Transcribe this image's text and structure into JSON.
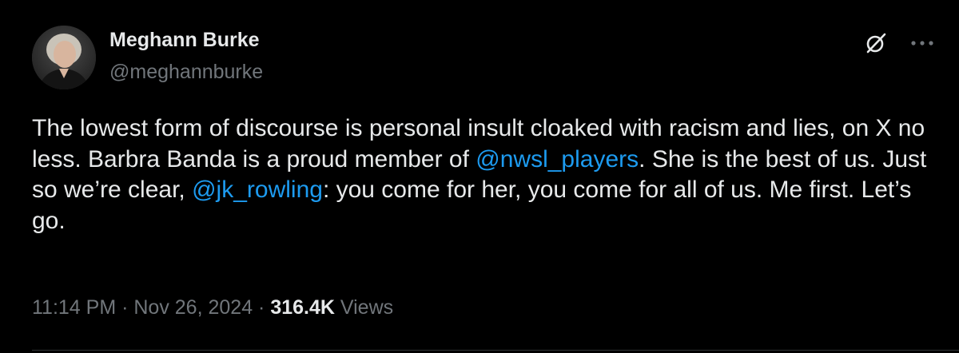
{
  "author": {
    "display_name": "Meghann Burke",
    "handle": "@meghannburke"
  },
  "actions": {
    "grok_icon": "grok-icon",
    "more_icon": "more-horizontal-icon"
  },
  "tweet": {
    "text_part1": "The lowest form of discourse is personal insult cloaked with racism and lies, on X no less. Barbra Banda is a proud member of ",
    "mention1": "@nwsl_players",
    "text_part2": ". She is the best of us. Just so we’re clear, ",
    "mention2": "@jk_rowling",
    "text_part3": ": you come for her, you come for all of us. Me first. Let’s go."
  },
  "meta": {
    "time": "11:14 PM",
    "sep1": " · ",
    "date": "Nov 26, 2024",
    "sep2": " · ",
    "views_count": "316.4K",
    "views_label": " Views"
  },
  "colors": {
    "background": "#000000",
    "text": "#e7e9ea",
    "secondary": "#71767b",
    "link": "#1d9bf0",
    "divider": "#2f3336"
  }
}
